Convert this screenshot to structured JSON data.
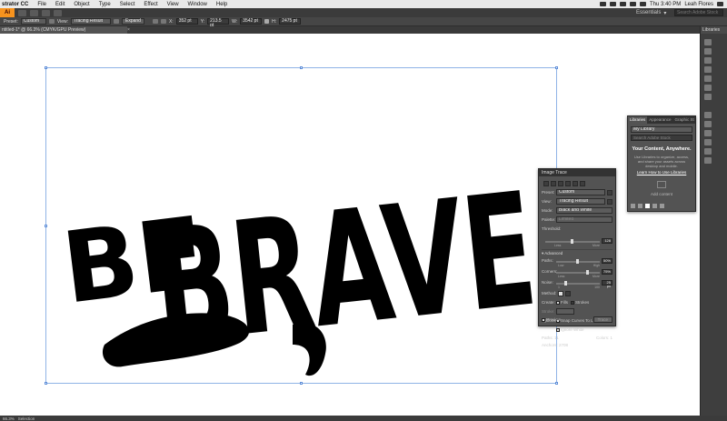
{
  "menubar": {
    "app": "strator CC",
    "items": [
      "File",
      "Edit",
      "Object",
      "Type",
      "Select",
      "Effect",
      "View",
      "Window",
      "Help"
    ],
    "clock": "Thu 3:40 PM",
    "user": "Leah Flores"
  },
  "appbar": {
    "logo": "Ai",
    "workspace": "Essentials",
    "search_placeholder": "Search Adobe Stock"
  },
  "controlbar": {
    "preset_label": "Preset:",
    "preset_value": "Custom",
    "view_label": "View:",
    "view_value": "Tracing Result",
    "expand_label": "Expand",
    "x_label": "X:",
    "x_value": "352 pt",
    "y_label": "Y:",
    "y_value": "213.5 pt",
    "w_label": "W:",
    "w_value": "3542 pt",
    "h_label": "H:",
    "h_value": "2475 pt"
  },
  "doctab": {
    "title": "ntitled-1* @ 66.3% (CMYK/GPU Preview)",
    "close": "×"
  },
  "artwork": {
    "word1": "BE",
    "word2": "BRAVE"
  },
  "right_panel": {
    "libraries_tab": "Libraries"
  },
  "libraries": {
    "tabs": [
      "Libraries",
      "Appearance",
      "Graphic St"
    ],
    "library_select": "My Library",
    "search_placeholder": "Search Adobe Stock",
    "heading": "Your Content, Anywhere.",
    "description": "Use Libraries to organize, access, and share your assets across desktop and mobile.",
    "link": "Learn How to Use Libraries",
    "drop_hint": "Add content"
  },
  "image_trace": {
    "title": "Image Trace",
    "preset_label": "Preset:",
    "preset_value": "Custom",
    "view_label": "View:",
    "view_value": "Tracing Result",
    "mode_label": "Mode:",
    "mode_value": "Black and White",
    "palette_label": "Palette:",
    "palette_value": "Limited",
    "threshold_label": "Threshold:",
    "threshold_value": "128",
    "threshold_fraction": 0.5,
    "less": "Less",
    "more": "More",
    "advanced": "Advanced",
    "paths_label": "Paths:",
    "paths_value": "50%",
    "paths_fraction": 0.5,
    "low": "Low",
    "high": "High",
    "corners_label": "Corners:",
    "corners_value": "75%",
    "corners_fraction": 0.75,
    "noise_label": "Noise:",
    "noise_value": "25 px",
    "noise_fraction": 0.2,
    "noise_min": "1",
    "noise_max": "100",
    "method_label": "Method:",
    "create_label": "Create:",
    "fills_label": "Fills",
    "strokes_label": "Strokes",
    "stroke_label": "Stroke:",
    "options_label": "Options:",
    "snap_label": "Snap Curves To Lines",
    "ignore_label": "Ignore White",
    "paths_count_label": "Paths:",
    "paths_count": "11",
    "colors_label": "Colors:",
    "colors_count": "1",
    "anchors_label": "Anchors:",
    "anchors_count": "2708",
    "preview_label": "Preview",
    "trace_button": "Trace"
  },
  "statusbar": {
    "zoom": "66.3%",
    "tool": "Selection"
  }
}
